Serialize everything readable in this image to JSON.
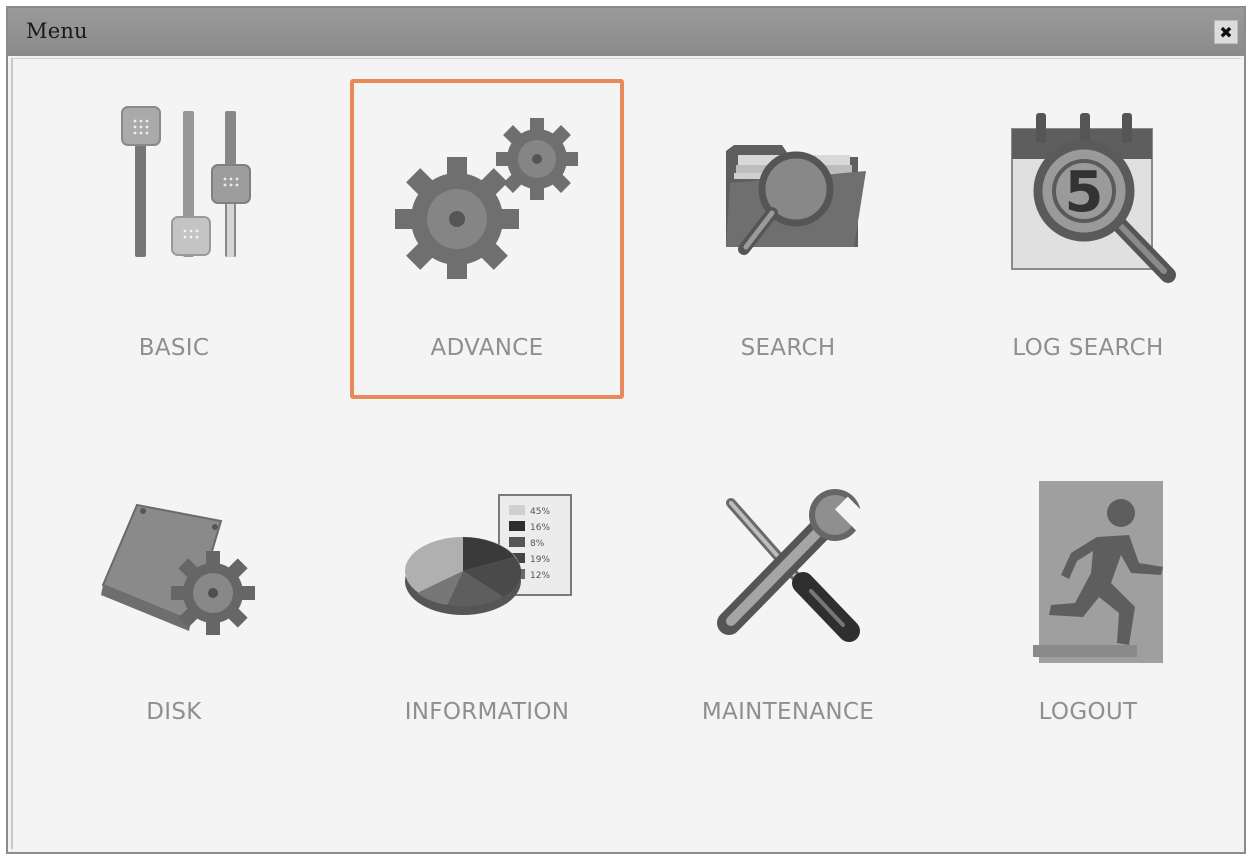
{
  "window": {
    "title": "Menu",
    "close_glyph": "✖"
  },
  "menu": [
    {
      "id": "basic",
      "label": "BASIC",
      "icon": "sliders-icon",
      "selected": false
    },
    {
      "id": "advance",
      "label": "ADVANCE",
      "icon": "gears-icon",
      "selected": true
    },
    {
      "id": "search",
      "label": "SEARCH",
      "icon": "folder-search-icon",
      "selected": false
    },
    {
      "id": "log-search",
      "label": "LOG SEARCH",
      "icon": "calendar-search-icon",
      "selected": false
    },
    {
      "id": "disk",
      "label": "DISK",
      "icon": "disk-gear-icon",
      "selected": false
    },
    {
      "id": "information",
      "label": "INFORMATION",
      "icon": "pie-chart-icon",
      "selected": false
    },
    {
      "id": "maintenance",
      "label": "MAINTENANCE",
      "icon": "tools-icon",
      "selected": false
    },
    {
      "id": "logout",
      "label": "LOGOUT",
      "icon": "exit-icon",
      "selected": false
    }
  ],
  "information_icon": {
    "legend_values": [
      "45%",
      "16%",
      "8%",
      "19%",
      "12%"
    ]
  },
  "log_search_icon": {
    "day": "5"
  },
  "colors": {
    "selection_border": "#e8895a",
    "label": "#8f8f8f",
    "titlebar": "#8f8f8f"
  }
}
